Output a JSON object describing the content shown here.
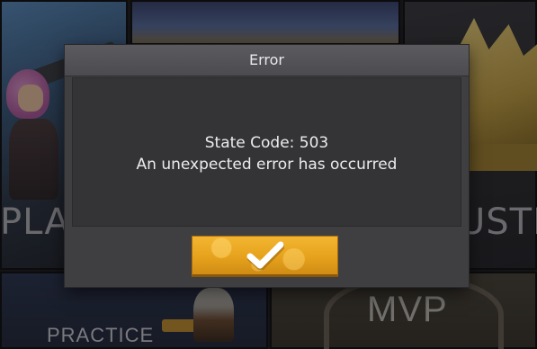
{
  "background_tiles": {
    "play_label": "PLAY",
    "cluster_label": "USTER",
    "practice_label": "PRACTICE",
    "mvp_label": "MVP"
  },
  "dialog": {
    "title": "Error",
    "message_line1": "State Code: 503",
    "message_line2": "An unexpected error has occurred",
    "confirm_icon": "checkmark-icon"
  },
  "colors": {
    "dialog_bg": "#3f3f42",
    "dialog_header": "#55555a",
    "dialog_body": "#343437",
    "confirm_button": "#e6a21c",
    "checkmark": "#ffffff"
  }
}
